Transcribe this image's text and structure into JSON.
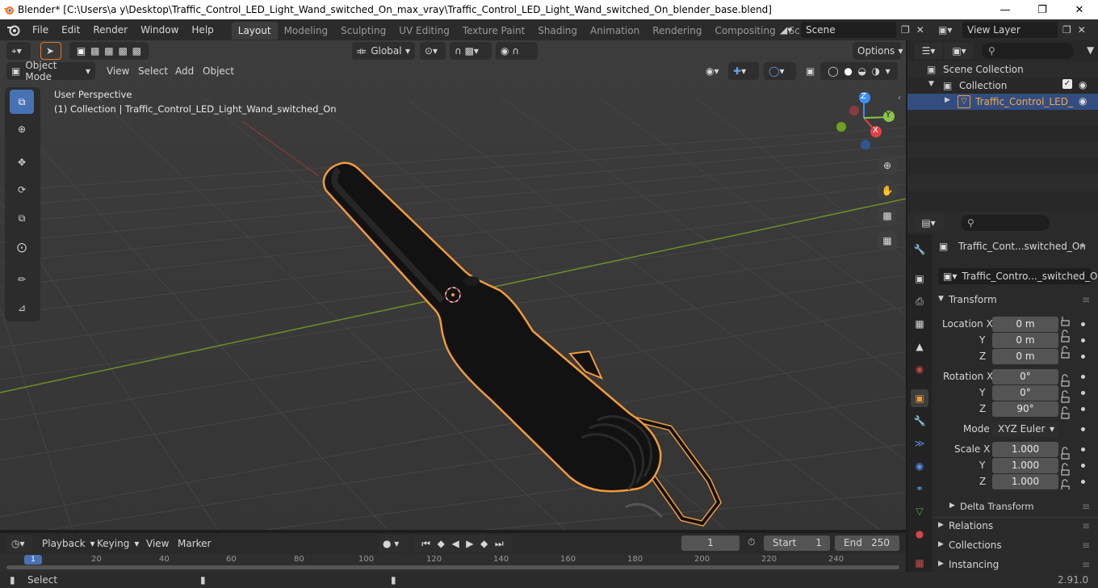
{
  "window": {
    "title": "Blender* [C:\\Users\\a y\\Desktop\\Traffic_Control_LED_Light_Wand_switched_On_max_vray\\Traffic_Control_LED_Light_Wand_switched_On_blender_base.blend]"
  },
  "menu": [
    "File",
    "Edit",
    "Render",
    "Window",
    "Help"
  ],
  "workspaces": [
    "Layout",
    "Modeling",
    "Sculpting",
    "UV Editing",
    "Texture Paint",
    "Shading",
    "Animation",
    "Rendering",
    "Compositing",
    "Scripting"
  ],
  "active_workspace": "Layout",
  "scene": "Scene",
  "view_layer": "View Layer",
  "viewport": {
    "transform_orientation": "Global",
    "options_label": "Options",
    "mode": "Object Mode",
    "header_menus": [
      "View",
      "Select",
      "Add",
      "Object"
    ],
    "info_line1": "User Perspective",
    "info_line2": "(1) Collection | Traffic_Control_LED_Light_Wand_switched_On",
    "gizmo": {
      "x": "X",
      "y": "Y",
      "z": "Z"
    }
  },
  "outliner": {
    "items": [
      {
        "label": "Scene Collection"
      },
      {
        "label": "Collection"
      },
      {
        "label": "Traffic_Control_LED_"
      }
    ]
  },
  "properties": {
    "object_name": "Traffic_Cont...switched_On",
    "data_name": "Traffic_Contro..._switched_On",
    "transform_title": "Transform",
    "location": {
      "label": "Location X",
      "x": "0 m",
      "y": "0 m",
      "z": "0 m"
    },
    "rotation": {
      "label": "Rotation X",
      "x": "0°",
      "y": "0°",
      "z": "90°"
    },
    "mode_label": "Mode",
    "mode_value": "XYZ Euler",
    "scale": {
      "label": "Scale X",
      "x": "1.000",
      "y": "1.000",
      "z": "1.000"
    },
    "axis_y": "Y",
    "axis_z": "Z",
    "delta_transform": "Delta Transform",
    "relations": "Relations",
    "collections": "Collections",
    "instancing": "Instancing"
  },
  "timeline": {
    "menus": [
      "Playback",
      "Keying",
      "View",
      "Marker"
    ],
    "current_frame": "1",
    "start_label": "Start",
    "start": "1",
    "end_label": "End",
    "end": "250",
    "ruler": [
      "1",
      "20",
      "40",
      "60",
      "80",
      "100",
      "120",
      "140",
      "160",
      "180",
      "200",
      "220",
      "240"
    ]
  },
  "status": {
    "left": "Select",
    "version": "2.91.0"
  },
  "colors": {
    "accent": "#4772b3",
    "selection_outline": "#f29a3a",
    "axis_x": "#e2414a",
    "axis_y": "#8bc34a",
    "axis_z": "#3f8ef5"
  }
}
